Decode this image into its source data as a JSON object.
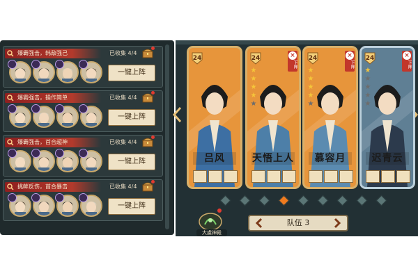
{
  "team_list": [
    {
      "tag": "爆霸强击，韩敌强己",
      "collected": "已收集 4/4",
      "button": "一键上阵"
    },
    {
      "tag": "爆霸强击，操作简单",
      "collected": "已收集 4/4",
      "button": "一键上阵"
    },
    {
      "tag": "爆霸强击，首合超神",
      "collected": "已收集 4/4",
      "button": "一键上阵"
    },
    {
      "tag": "挑衅反伤，首合暴击",
      "collected": "已收集 4/4",
      "button": "一键上阵"
    }
  ],
  "heroes": [
    {
      "name": "吕风",
      "level": "24",
      "stars": 0,
      "max_stars": 5,
      "remove_label": "",
      "color": "orange"
    },
    {
      "name": "天悟上人",
      "level": "24",
      "stars": 4,
      "max_stars": 5,
      "remove_label": "下阵",
      "color": "orange"
    },
    {
      "name": "慕容月",
      "level": "24",
      "stars": 4,
      "max_stars": 5,
      "remove_label": "下阵",
      "color": "orange"
    },
    {
      "name": "迟青云",
      "level": "24",
      "stars": 1,
      "max_stars": 5,
      "remove_label": "下阵",
      "color": "blue"
    }
  ],
  "pagination": {
    "count": 9,
    "active_index": 3
  },
  "team_selector": {
    "label": "队伍 3"
  },
  "skill": {
    "label": "大虞神殿",
    "icon": "skill-emblem-icon"
  },
  "colors": {
    "orange_card": "#e7953b",
    "blue_card": "#5f7f94",
    "accent_red": "#c2372b",
    "gold": "#c9a86a"
  }
}
